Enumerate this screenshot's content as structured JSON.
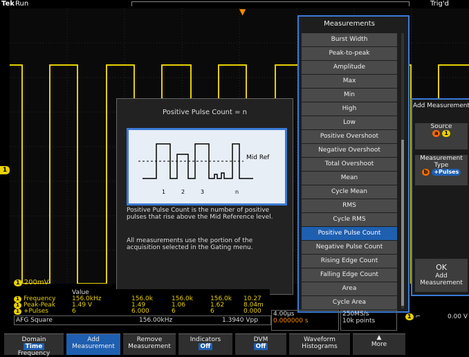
{
  "status": {
    "brand": "Tek",
    "run": "Run",
    "trigger": "Trig'd"
  },
  "channel": {
    "marker": "1",
    "scale": "200mV"
  },
  "info_panel": {
    "title": "Positive Pulse Count = n",
    "diagram_label": "Mid Ref",
    "pulse_labels": [
      "1",
      "2",
      "3",
      "n"
    ],
    "text1": "Positive Pulse Count is the number of positive pulses that rise above the Mid Reference level.",
    "text2": "All measurements use the portion of the acquisition selected in the Gating menu."
  },
  "measurements": {
    "title": "Measurements",
    "items": [
      "Burst Width",
      "Peak-to-peak",
      "Amplitude",
      "Max",
      "Min",
      "High",
      "Low",
      "Positive Overshoot",
      "Negative Overshoot",
      "Total Overshoot",
      "Mean",
      "Cycle Mean",
      "RMS",
      "Cycle RMS",
      "Positive Pulse Count",
      "Negative Pulse Count",
      "Rising Edge Count",
      "Falling Edge Count",
      "Area",
      "Cycle Area"
    ],
    "selected": "Positive Pulse Count"
  },
  "side": {
    "title": "Add Measurement",
    "source_label": "Source",
    "source_badge_a": "a",
    "source_badge_ch": "1",
    "type_label": "Measurement Type",
    "type_badge": "b",
    "type_value": "+Pulses",
    "ok_label": "OK",
    "ok_sub": "Add Measurement"
  },
  "table": {
    "header": "Value",
    "rows": [
      {
        "ch": "1",
        "name": "Frequency",
        "value": "156.0kHz",
        "c1": "156.0k",
        "c2": "156.0k",
        "c3": "156.0k",
        "c4": "10.27"
      },
      {
        "ch": "1",
        "name": "Peak-Peak",
        "value": "1.49 V",
        "c1": "1.49",
        "c2": "1.06",
        "c3": "1.62",
        "c4": "8.04m"
      },
      {
        "ch": "1",
        "name": "+Pulses",
        "value": "6",
        "c1": "6.000",
        "c2": "6",
        "c3": "6",
        "c4": "0.000"
      }
    ]
  },
  "afg": {
    "label": "AFG Square",
    "freq": "156.00kHz",
    "vpp": "1.3940 Vpp"
  },
  "timebase": {
    "scale": "4.00µs",
    "delay": "0.000000 s",
    "rate": "250MS/s",
    "points": "10k points"
  },
  "trigger_readout": {
    "ch": "1",
    "slope": "♩",
    "level": "0.00 V"
  },
  "menu": [
    {
      "line1": "Domain",
      "pill": "Time",
      "line2": "Frequency"
    },
    {
      "line1": "Add",
      "line2": "Measurement"
    },
    {
      "line1": "Remove",
      "line2": "Measurement"
    },
    {
      "line1": "Indicators",
      "pill": "Off"
    },
    {
      "line1": "DVM",
      "pill": "Off"
    },
    {
      "line1": "Waveform",
      "line2": "Histograms"
    },
    {
      "line1": "More"
    }
  ],
  "colors": {
    "ch1": "#e8d000",
    "accent": "#1f5fb0",
    "trigger": "#ff8c00"
  }
}
